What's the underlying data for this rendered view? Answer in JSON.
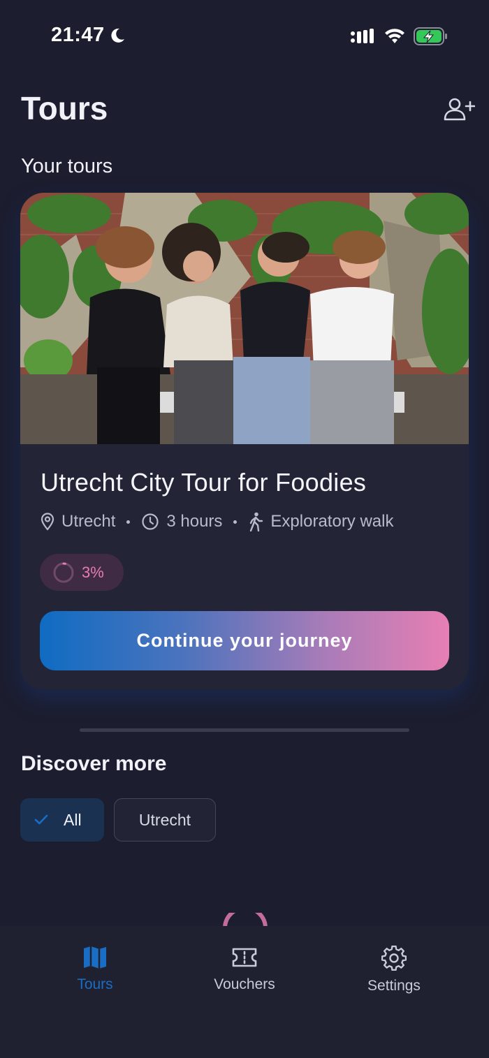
{
  "status_bar": {
    "time": "21:47"
  },
  "header": {
    "title": "Tours"
  },
  "your_tours": {
    "heading": "Your tours",
    "card": {
      "title": "Utrecht City Tour for Foodies",
      "location": "Utrecht",
      "duration": "3 hours",
      "type": "Exploratory walk",
      "progress_label": "3%",
      "progress_value": 0.03,
      "cta_label": "Continue your journey"
    }
  },
  "discover": {
    "heading": "Discover more",
    "filters": [
      {
        "label": "All",
        "selected": true
      },
      {
        "label": "Utrecht",
        "selected": false
      }
    ]
  },
  "tab_bar": {
    "tabs": [
      {
        "label": "Tours",
        "icon": "map-icon",
        "active": true
      },
      {
        "label": "Vouchers",
        "icon": "ticket-icon",
        "active": false
      },
      {
        "label": "Settings",
        "icon": "gear-icon",
        "active": false
      }
    ]
  },
  "colors": {
    "background": "#1c1d2e",
    "card": "#232536",
    "accent_blue": "#1a6dc4",
    "accent_pink": "#e87db0"
  }
}
